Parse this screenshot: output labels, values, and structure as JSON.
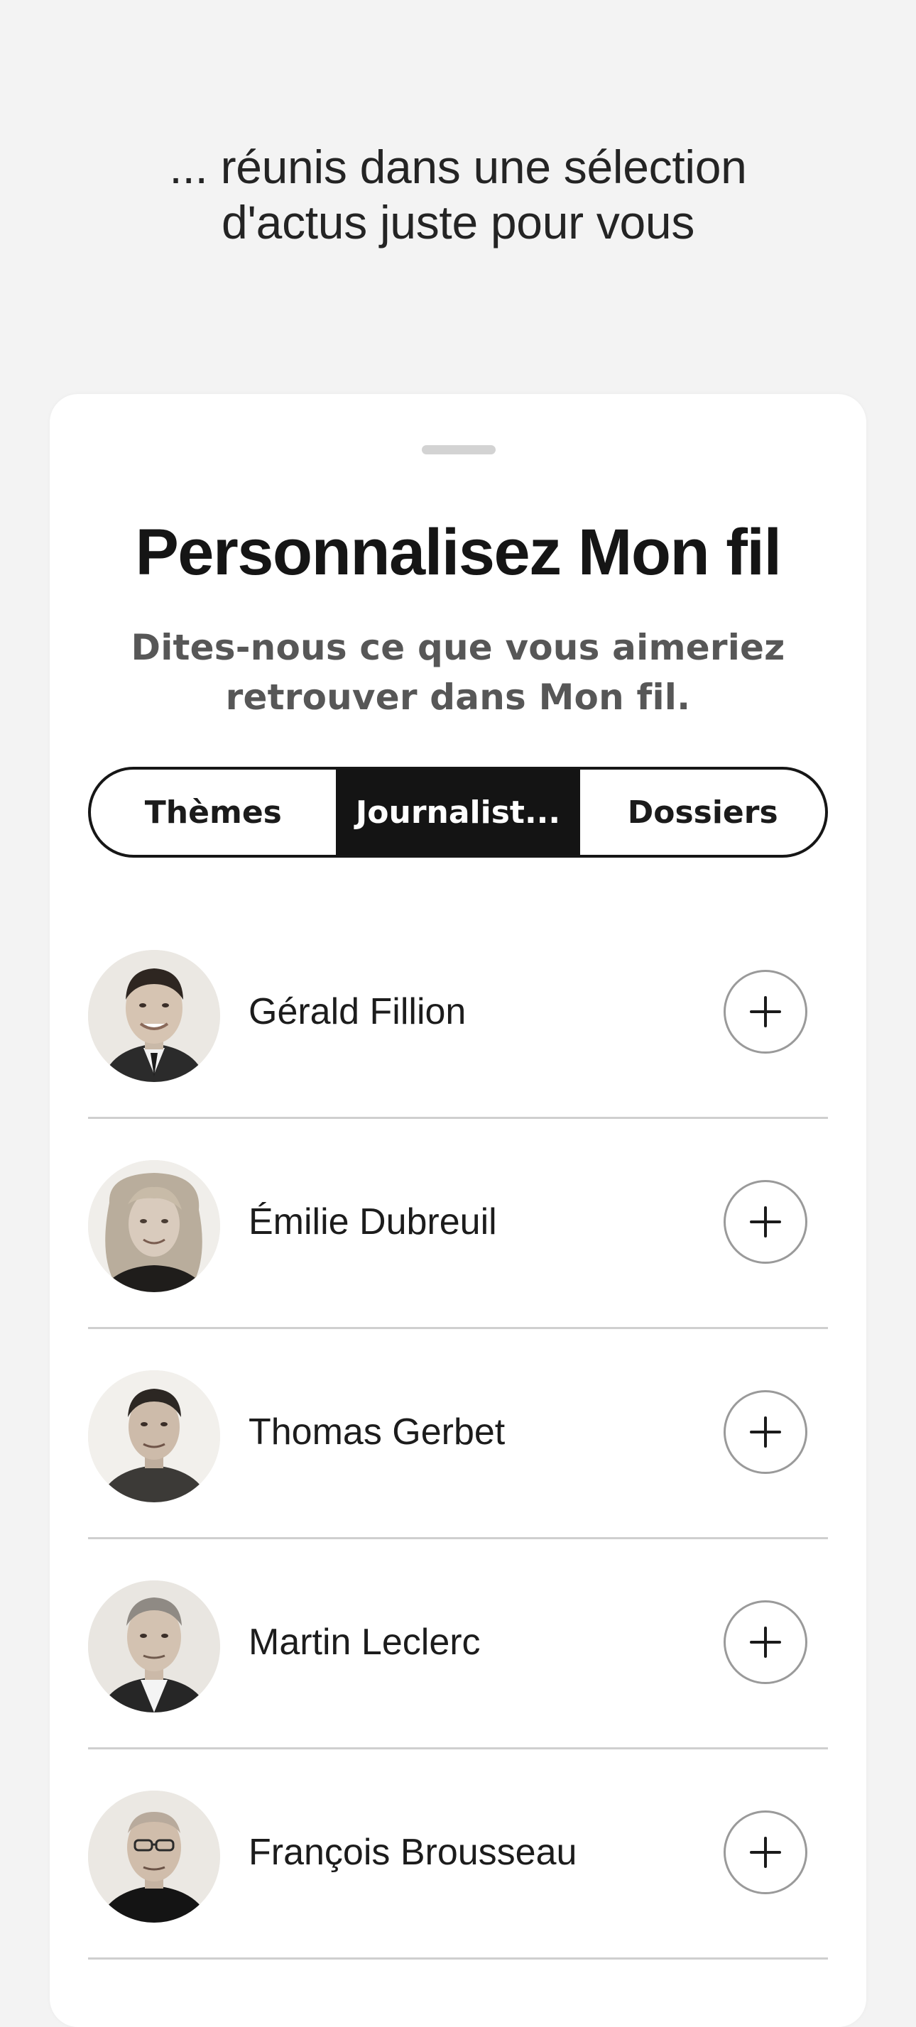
{
  "intro": {
    "line1": "... réunis dans une sélection",
    "line2": "d'actus juste pour vous"
  },
  "sheet": {
    "title": "Personnalisez Mon fil",
    "subtitle_line1": "Dites-nous ce que vous aimeriez",
    "subtitle_line2": "retrouver dans Mon fil."
  },
  "tabs": [
    {
      "label": "Thèmes",
      "active": false
    },
    {
      "label": "Journalist...",
      "active": true
    },
    {
      "label": "Dossiers",
      "active": false
    }
  ],
  "journalists": [
    {
      "name": "Gérald Fillion",
      "avatar": "portrait-photo",
      "action_icon": "plus-icon"
    },
    {
      "name": "Émilie Dubreuil",
      "avatar": "portrait-photo",
      "action_icon": "plus-icon"
    },
    {
      "name": "Thomas Gerbet",
      "avatar": "portrait-photo",
      "action_icon": "plus-icon"
    },
    {
      "name": "Martin Leclerc",
      "avatar": "portrait-photo",
      "action_icon": "plus-icon"
    },
    {
      "name": "François Brousseau",
      "avatar": "portrait-photo",
      "action_icon": "plus-icon"
    }
  ],
  "colors": {
    "background": "#f3f3f3",
    "sheet": "#ffffff",
    "active_tab": "#141414",
    "divider": "#cfcfcf"
  }
}
